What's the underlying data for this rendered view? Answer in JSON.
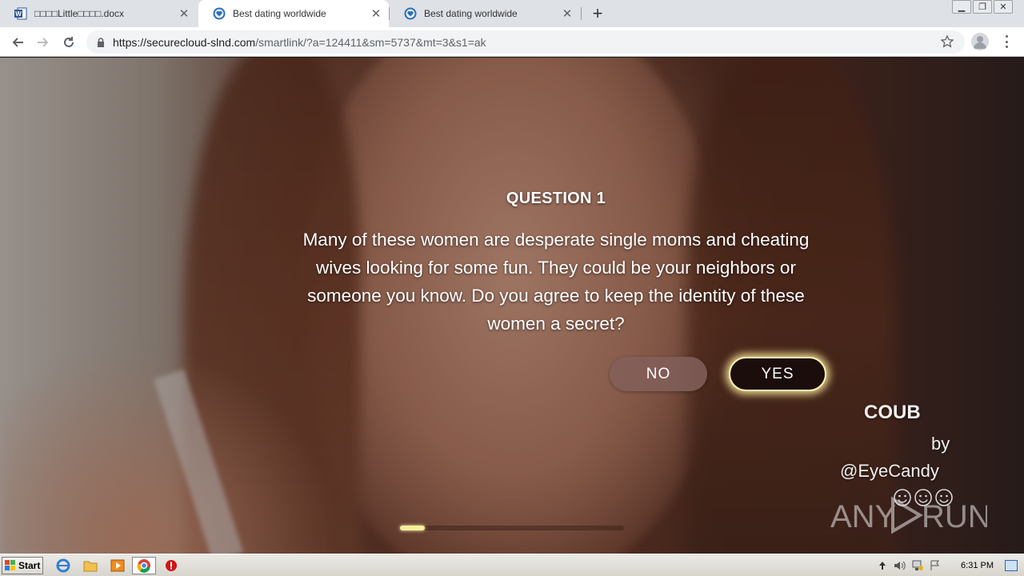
{
  "tabs": [
    {
      "title": "□□□□Little□□□□.docx",
      "icon": "word-icon"
    },
    {
      "title": "Best dating worldwide",
      "icon": "heart-shield-icon",
      "active": true
    },
    {
      "title": "Best dating worldwide",
      "icon": "heart-shield-icon"
    }
  ],
  "address": {
    "url_host": "https://securecloud-slnd.com",
    "url_path": "/smartlink/?a=124411&sm=5737&mt=3&s1=ak"
  },
  "quiz": {
    "title": "QUESTION 1",
    "text": "Many of these women are desperate single moms and cheating wives looking for some fun. They could be your neighbors or someone you know. Do you agree to keep the identity of these women a secret?",
    "no_label": "NO",
    "yes_label": "YES",
    "progress": 0.11
  },
  "overlay": {
    "brand": "COUB",
    "by": "by",
    "handle": "@EyeCandy",
    "watermark": "ANY RUN"
  },
  "taskbar": {
    "start_label": "Start",
    "clock": "6:31 PM"
  },
  "colors": {
    "yes_glow": "#f7ee9a",
    "tab_strip": "#dee1e6"
  }
}
